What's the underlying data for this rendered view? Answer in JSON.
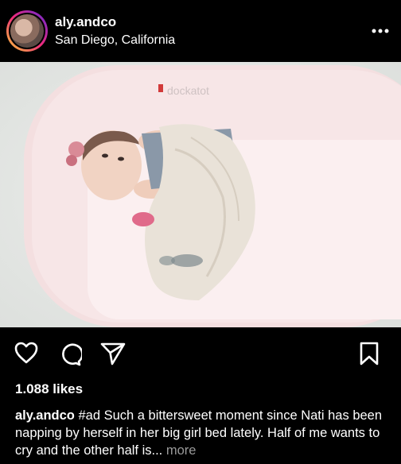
{
  "post": {
    "username": "aly.andco",
    "location": "San Diego, California",
    "likes_text": "1.088 likes",
    "caption_user": "aly.andco",
    "caption_text": " #ad Such a bittersweet moment since Nati has been napping by herself in her big girl bed lately. Half of me wants to cry and the other half is...",
    "more_label": "more",
    "photo_brand_text": "dockatot"
  },
  "icons": {
    "options": "more-options-icon",
    "like": "heart-icon",
    "comment": "comment-icon",
    "share": "send-icon",
    "save": "bookmark-icon"
  },
  "colors": {
    "background": "#000000",
    "text": "#ffffff",
    "muted": "#9a9a9a"
  }
}
